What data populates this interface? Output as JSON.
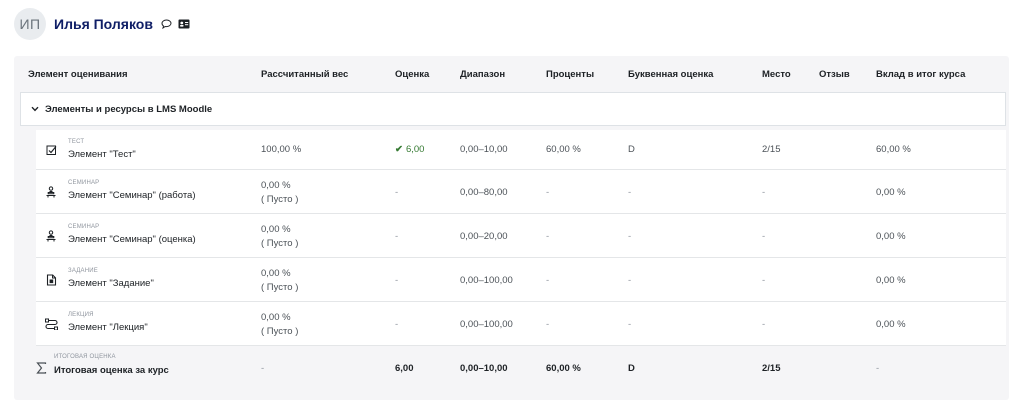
{
  "user": {
    "initials": "ИП",
    "name": "Илья Поляков"
  },
  "table": {
    "headers": {
      "item": "Элемент оценивания",
      "weight": "Рассчитанный вес",
      "grade": "Оценка",
      "range": "Диапазон",
      "percent": "Проценты",
      "letter": "Буквенная оценка",
      "rank": "Место",
      "feedback": "Отзыв",
      "contribution": "Вклад в итог курса"
    },
    "category": {
      "name": "Элементы и ресурсы в LMS Moodle"
    },
    "rows": [
      {
        "icon": "checkbox-icon",
        "type": "ТЕСТ",
        "name": "Элемент \"Тест\"",
        "weight": "100,00 %",
        "weight_note": "",
        "grade": "6,00",
        "range": "0,00–10,00",
        "percent": "60,00 %",
        "letter": "D",
        "rank": "2/15",
        "contribution": "60,00 %"
      },
      {
        "icon": "workshop-icon",
        "type": "СЕМИНАР",
        "name": "Элемент \"Семинар\" (работа)",
        "weight": "0,00 %",
        "weight_note": "( Пусто )",
        "grade": "-",
        "range": "0,00–80,00",
        "percent": "-",
        "letter": "-",
        "rank": "-",
        "contribution": "0,00 %"
      },
      {
        "icon": "workshop-icon",
        "type": "СЕМИНАР",
        "name": "Элемент \"Семинар\" (оценка)",
        "weight": "0,00 %",
        "weight_note": "( Пусто )",
        "grade": "-",
        "range": "0,00–20,00",
        "percent": "-",
        "letter": "-",
        "rank": "-",
        "contribution": "0,00 %"
      },
      {
        "icon": "assignment-icon",
        "type": "ЗАДАНИЕ",
        "name": "Элемент \"Задание\"",
        "weight": "0,00 %",
        "weight_note": "( Пусто )",
        "grade": "-",
        "range": "0,00–100,00",
        "percent": "-",
        "letter": "-",
        "rank": "-",
        "contribution": "0,00 %"
      },
      {
        "icon": "lesson-icon",
        "type": "ЛЕКЦИЯ",
        "name": "Элемент \"Лекция\"",
        "weight": "0,00 %",
        "weight_note": "( Пусто )",
        "grade": "-",
        "range": "0,00–100,00",
        "percent": "-",
        "letter": "-",
        "rank": "-",
        "contribution": "0,00 %"
      }
    ],
    "total": {
      "icon": "sigma-icon",
      "type": "ИТОГОВАЯ ОЦЕНКА",
      "name": "Итоговая оценка за курс",
      "weight": "-",
      "grade": "6,00",
      "range": "0,00–10,00",
      "percent": "60,00 %",
      "letter": "D",
      "rank": "2/15",
      "contribution": "-"
    }
  },
  "colors": {
    "accent": "#0f1e66",
    "success": "#357a32",
    "panel_bg": "#f5f5f7"
  }
}
